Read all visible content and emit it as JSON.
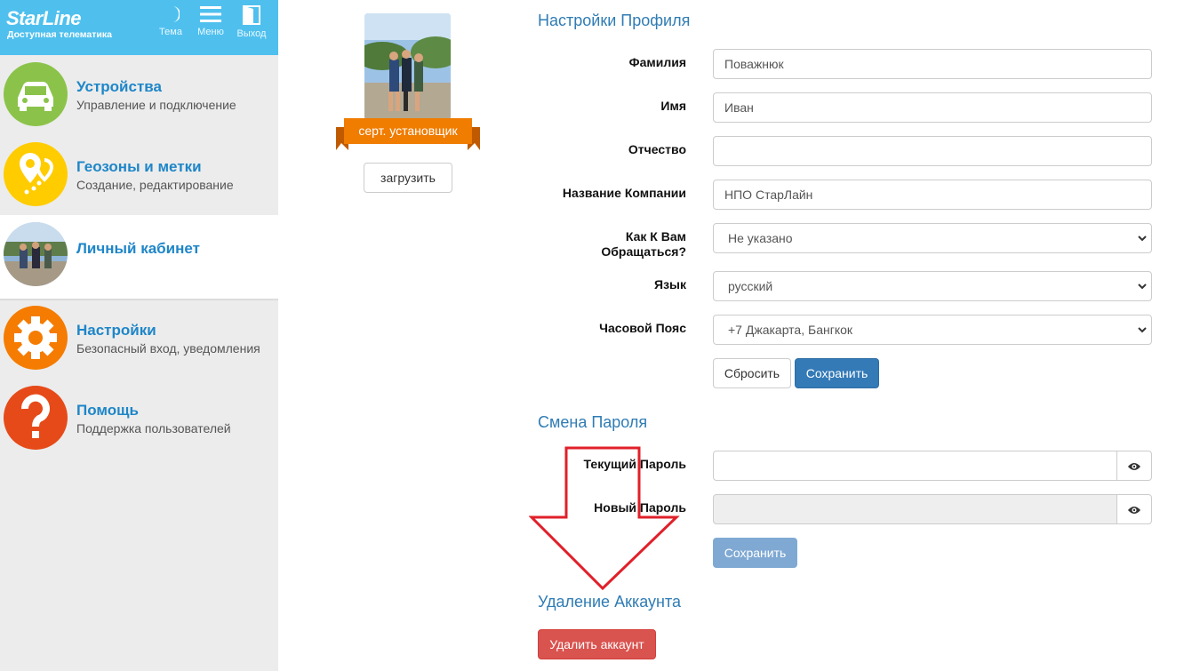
{
  "sidebar": {
    "logo": "StarLine",
    "logo_sub": "Доступная телематика",
    "topbar": [
      {
        "label": "Тема",
        "icon": "moon-icon"
      },
      {
        "label": "Меню",
        "icon": "menu-icon"
      },
      {
        "label": "Выход",
        "icon": "exit-door-icon"
      }
    ],
    "items": [
      {
        "title": "Устройства",
        "subtitle": "Управление и подключение",
        "icon": "car-icon",
        "color": "#8bc34a"
      },
      {
        "title": "Геозоны и метки",
        "subtitle": "Создание, редактирование",
        "icon": "geo-pin-icon",
        "color": "#ffcc00"
      },
      {
        "title": "Личный кабинет",
        "subtitle": "",
        "icon": "user-avatar",
        "active": true
      },
      {
        "title": "Настройки",
        "subtitle": "Безопасный вход, уведомления",
        "icon": "gear-icon",
        "color": "#f57c00"
      },
      {
        "title": "Помощь",
        "subtitle": "Поддержка пользователей",
        "icon": "question-icon",
        "color": "#e64a19"
      }
    ]
  },
  "avatar": {
    "badge": "серт. установщик",
    "upload_label": "загрузить"
  },
  "profile": {
    "title": "Настройки Профиля",
    "fields": [
      {
        "label": "Фамилия",
        "value": "Поважнюк"
      },
      {
        "label": "Имя",
        "value": "Иван"
      },
      {
        "label": "Отчество",
        "value": ""
      },
      {
        "label": "Название Компании",
        "value": "НПО СтарЛайн"
      }
    ],
    "address_label_1": "Как К Вам",
    "address_label_2": "Обращаться?",
    "address_value": "Не указано",
    "language_label": "Язык",
    "language_value": "русский",
    "timezone_label": "Часовой Пояс",
    "timezone_value": "+7 Джакарта, Бангкок",
    "reset_label": "Сбросить",
    "save_label": "Сохранить"
  },
  "password": {
    "title": "Смена Пароля",
    "current_label": "Текущий Пароль",
    "new_label": "Новый Пароль",
    "save_label": "Сохранить"
  },
  "delete": {
    "title": "Удаление Аккаунта",
    "button_label": "Удалить аккаунт"
  },
  "colors": {
    "topbar": "#4fc0ee",
    "accent_text": "#1e86c8",
    "section_title": "#2f7cb4",
    "primary": "#337ab7",
    "danger": "#d9534f",
    "badge": "#f07c00",
    "annotation": "#e0202a"
  }
}
